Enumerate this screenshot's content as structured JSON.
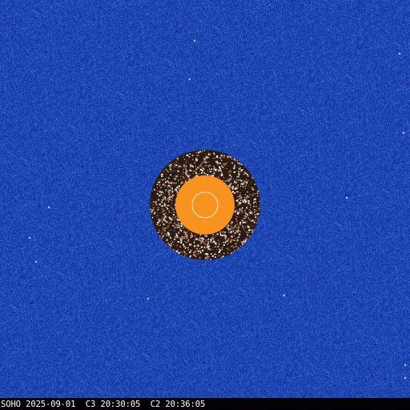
{
  "image": {
    "kind": "coronagraph-image",
    "colors": {
      "background": "#1e47b4",
      "occulter_disk": "#f7931e",
      "sun_outline": "#ffffff",
      "info_bar": "#000000",
      "info_text": "#ffffff"
    }
  },
  "caption": {
    "observatory": "SOHO",
    "date": "2025-09-01",
    "c3_label": "C3",
    "c3_time": "20:30:05",
    "c2_label": "C2",
    "c2_time": "20:36:05"
  }
}
